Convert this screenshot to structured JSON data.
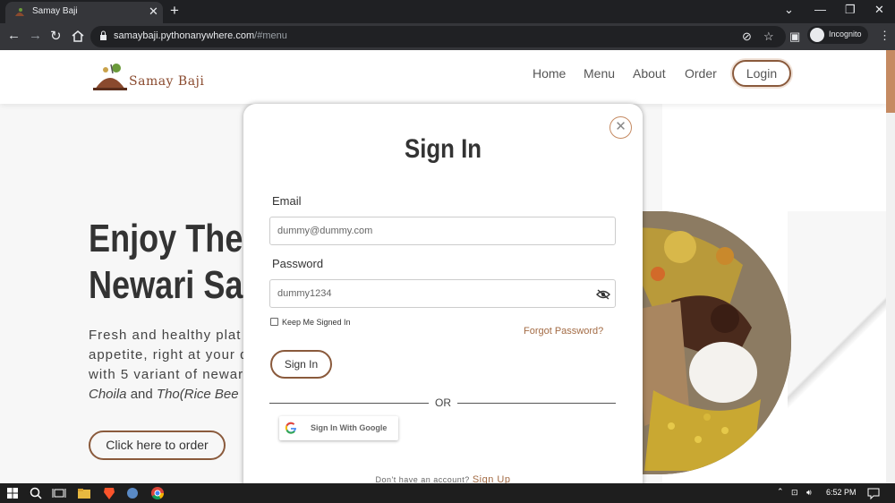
{
  "browser": {
    "tab_title": "Samay Baji",
    "tab_close": "✕",
    "new_tab": "+",
    "url_host": "samaybaji.pythonanywhere.com",
    "url_path": "/#menu",
    "incognito_label": "Incognito",
    "window_controls": [
      "—",
      "❐",
      "✕"
    ],
    "nav_icons": [
      "arrow-left-icon",
      "arrow-right-icon",
      "reload-icon",
      "home-icon"
    ]
  },
  "site": {
    "logo_text": "Samay Baji",
    "nav": [
      "Home",
      "Menu",
      "About",
      "Order"
    ],
    "login_label": "Login",
    "hero": {
      "title_line1": "Enjoy The T",
      "title_line2": "Newari Sa",
      "text_line1": "Fresh and healthy plat",
      "text_line2": "appetite, right at your d",
      "text_line3": "with 5 variant of newar",
      "text_line4_italic1": "Choila",
      "text_line4_mid": " and ",
      "text_line4_italic2": "Tho(Rice Bee",
      "order_button": "Click here to order"
    },
    "accent_color": "#8a5a3c"
  },
  "modal": {
    "close": "✕",
    "title": "Sign In",
    "email_label": "Email",
    "email_value": "dummy@dummy.com",
    "password_label": "Password",
    "password_value": "dummy1234",
    "keep_signed_in": "Keep Me Signed In",
    "forgot_password": "Forgot Password?",
    "signin_button": "Sign In",
    "or_text": "OR",
    "google_button": "Sign In With Google",
    "no_account_text": "Don't have an account?",
    "signup_link": "Sign Up"
  },
  "taskbar": {
    "time": "6:52 PM"
  }
}
